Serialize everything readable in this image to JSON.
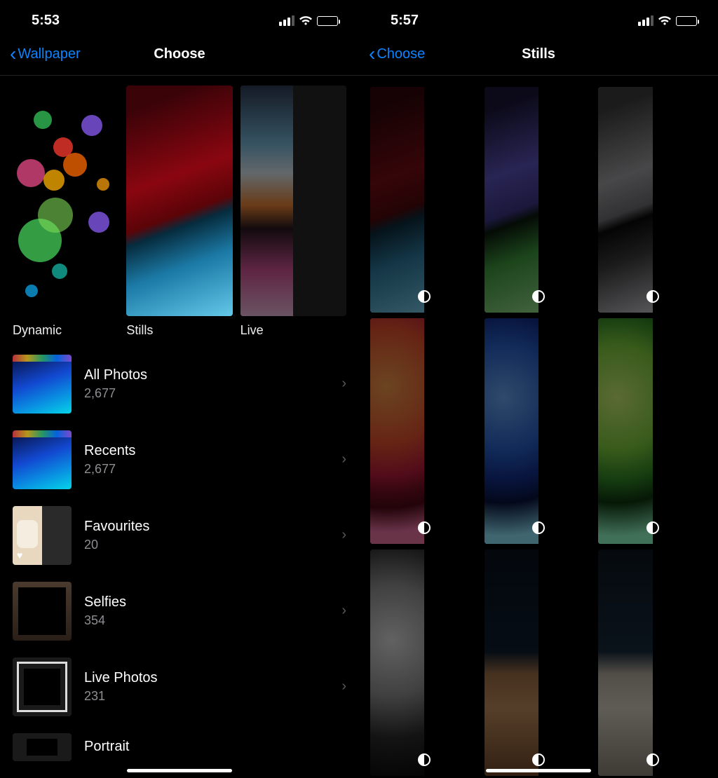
{
  "left": {
    "status": {
      "time": "5:53"
    },
    "nav": {
      "back": "Wallpaper",
      "title": "Choose"
    },
    "categories": [
      {
        "id": "dynamic",
        "label": "Dynamic"
      },
      {
        "id": "stills",
        "label": "Stills"
      },
      {
        "id": "live",
        "label": "Live"
      }
    ],
    "albums": [
      {
        "id": "all",
        "title": "All Photos",
        "count": "2,677"
      },
      {
        "id": "recents",
        "title": "Recents",
        "count": "2,677"
      },
      {
        "id": "favourites",
        "title": "Favourites",
        "count": "20"
      },
      {
        "id": "selfies",
        "title": "Selfies",
        "count": "354"
      },
      {
        "id": "live",
        "title": "Live Photos",
        "count": "231"
      },
      {
        "id": "portrait",
        "title": "Portrait",
        "count": ""
      }
    ]
  },
  "right": {
    "status": {
      "time": "5:57"
    },
    "nav": {
      "back": "Choose",
      "title": "Stills"
    }
  }
}
